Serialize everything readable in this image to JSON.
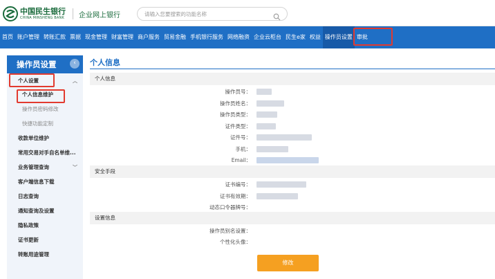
{
  "header": {
    "bank_name_cn": "中国民生银行",
    "bank_name_en": "CHINA MINSHENG BANK",
    "subtitle": "企业网上银行",
    "search_placeholder": "请输入您要搜索的功能名称"
  },
  "nav": {
    "items": [
      "首页",
      "账户管理",
      "转账汇款",
      "票据",
      "现金管理",
      "财富管理",
      "商户服务",
      "贸易金融",
      "手机银行服务",
      "网络融资",
      "企业云柜台",
      "民生e家",
      "权益",
      "操作员设置",
      "审批"
    ],
    "active_index": 13
  },
  "sidebar": {
    "title": "操作员设置",
    "collapse_icon": "chevron-left-icon",
    "items": [
      {
        "label": "个人设置",
        "level": 1,
        "expanded": true
      },
      {
        "label": "个人信息维护",
        "level": 2,
        "selected": true
      },
      {
        "label": "操作员密码修改",
        "level": 2
      },
      {
        "label": "快捷功能定制",
        "level": 2
      },
      {
        "label": "收款单位维护",
        "level": 1
      },
      {
        "label": "常用交易对手自名单维...",
        "level": 1
      },
      {
        "label": "业务管理查询",
        "level": 1,
        "expandable": true
      },
      {
        "label": "客户端信息下载",
        "level": 1
      },
      {
        "label": "日志查询",
        "level": 1
      },
      {
        "label": "通知查询及设置",
        "level": 1
      },
      {
        "label": "隐私政策",
        "level": 1
      },
      {
        "label": "证书更新",
        "level": 1
      },
      {
        "label": "转账用途管理",
        "level": 1
      }
    ]
  },
  "main": {
    "title": "个人信息",
    "sections": [
      {
        "title": "个人信息",
        "fields": [
          "操作员号：",
          "操作员姓名：",
          "操作员类型：",
          "证件类型：",
          "证件号：",
          "手机：",
          "Email："
        ]
      },
      {
        "title": "安全手段",
        "fields": [
          "证书编号：",
          "证书有效期：",
          "动态口令器牌号："
        ]
      },
      {
        "title": "设置信息",
        "fields": [
          "操作员别名设置：",
          "个性化头像："
        ]
      }
    ],
    "submit_label": "修改"
  },
  "colors": {
    "nav_blue": "#1f6fc5",
    "brand_green": "#1a6b3c",
    "highlight_red": "#e23a2f",
    "submit_orange": "#f5a021"
  }
}
